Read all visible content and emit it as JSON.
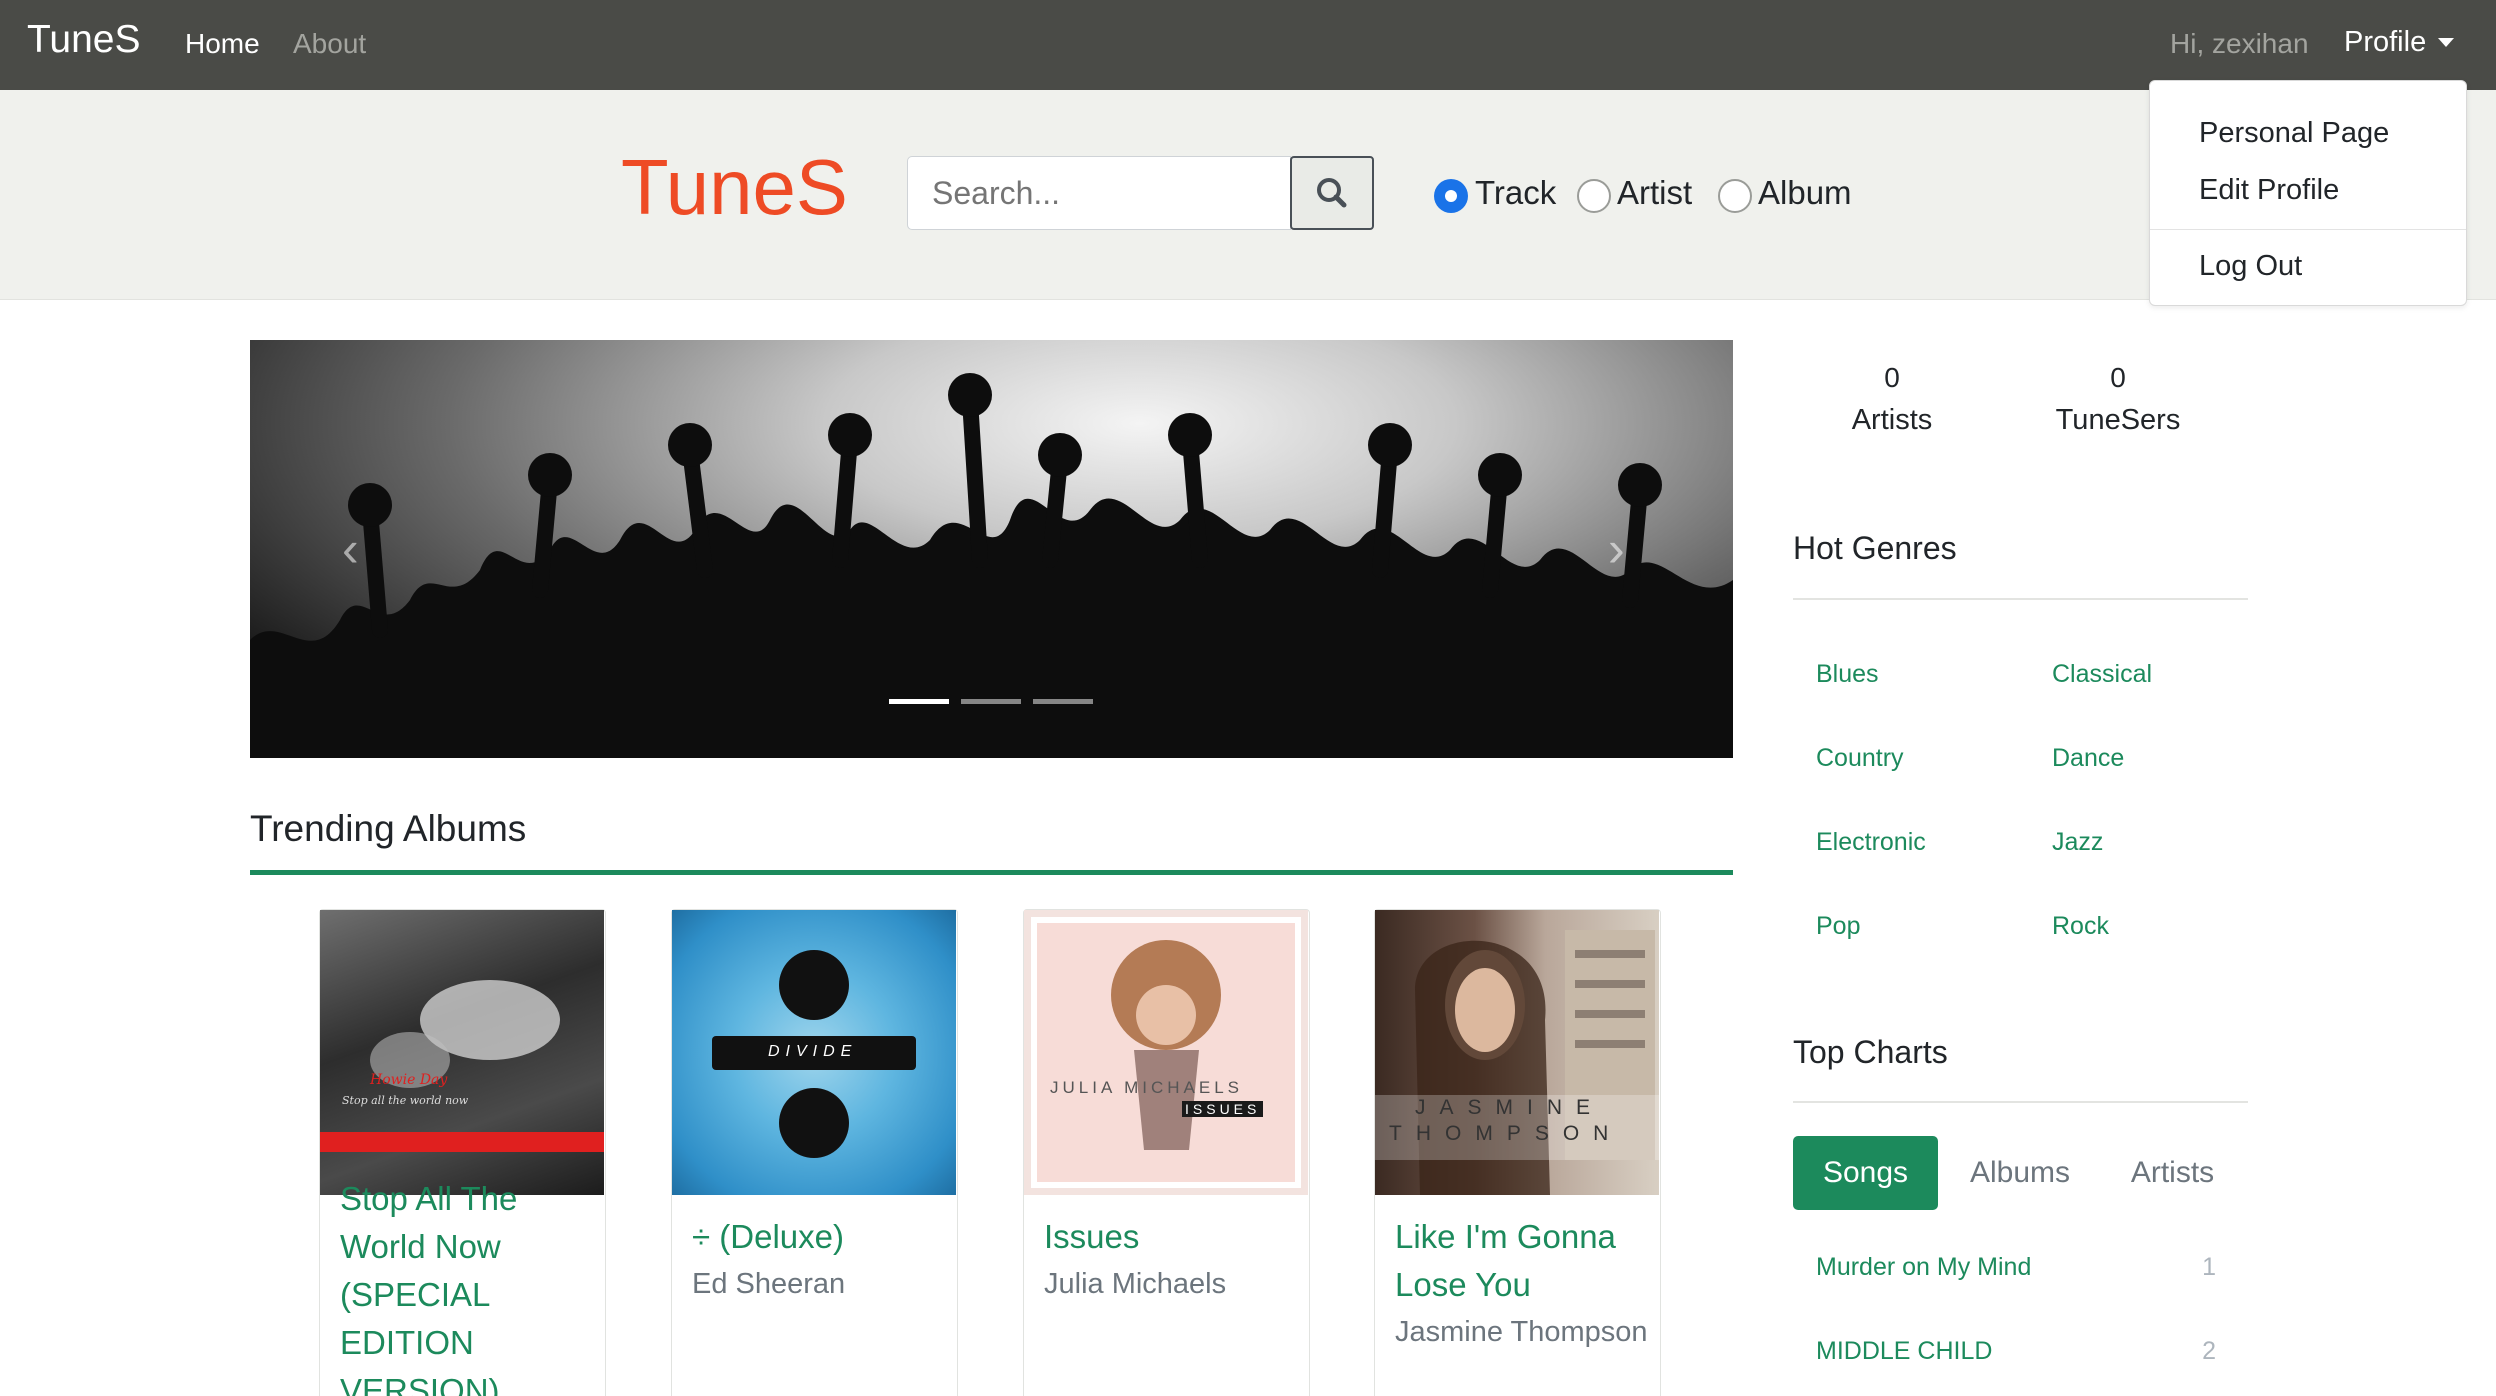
{
  "navbar": {
    "brand": "TuneS",
    "links": [
      "Home",
      "About"
    ],
    "greeting": "Hi, zexihan",
    "profile_label": "Profile"
  },
  "profile_menu": {
    "items": [
      "Personal Page",
      "Edit Profile"
    ],
    "logout": "Log Out"
  },
  "header": {
    "logo": "TuneS",
    "search_placeholder": "Search...",
    "search_icon": "search-icon",
    "search_types": [
      {
        "label": "Track",
        "checked": true
      },
      {
        "label": "Artist",
        "checked": false
      },
      {
        "label": "Album",
        "checked": false
      }
    ]
  },
  "carousel": {
    "prev_icon": "chevron-left-icon",
    "next_icon": "chevron-right-icon",
    "slide_count": 3,
    "active_slide": 1
  },
  "trending": {
    "title": "Trending Albums",
    "albums": [
      {
        "title": "Stop All The World Now (SPECIAL EDITION VERSION)",
        "artist": "",
        "cover_text": "Howie Day",
        "cover_sub": "Stop all the world now"
      },
      {
        "title": "÷ (Deluxe)",
        "artist": "Ed Sheeran",
        "cover_text": "DIVIDE"
      },
      {
        "title": "Issues",
        "artist": "Julia Michaels",
        "cover_text": "JULIA MICHAELS",
        "cover_sub": "ISSUES"
      },
      {
        "title": "Like I'm Gonna Lose You",
        "artist": "Jasmine Thompson",
        "cover_text": "JASMINE",
        "cover_sub": "THOMPSON"
      }
    ]
  },
  "stats": {
    "artists_count": "0",
    "artists_label": "Artists",
    "tunesers_count": "0",
    "tunesers_label": "TuneSers"
  },
  "hot_genres": {
    "title": "Hot Genres",
    "genres": [
      "Blues",
      "Classical",
      "Country",
      "Dance",
      "Electronic",
      "Jazz",
      "Pop",
      "Rock"
    ]
  },
  "top_charts": {
    "title": "Top Charts",
    "tabs": [
      {
        "label": "Songs",
        "active": true
      },
      {
        "label": "Albums",
        "active": false
      },
      {
        "label": "Artists",
        "active": false
      }
    ],
    "items": [
      {
        "name": "Murder on My Mind",
        "rank": "1"
      },
      {
        "name": "MIDDLE CHILD",
        "rank": "2"
      }
    ]
  },
  "colors": {
    "navbar": "#4a4b47",
    "logo": "#ee4b25",
    "accent_green": "#1c8a5c",
    "radio_checked": "#1a73e8"
  }
}
